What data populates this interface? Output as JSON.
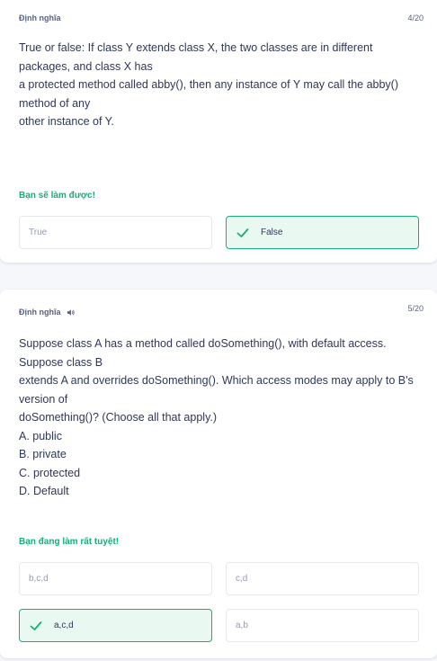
{
  "card1": {
    "category": "Định nghĩa",
    "counter": "4/20",
    "question": "True or false: If class Y extends class X, the two classes are in different packages, and class X has\na protected method called abby(), then any instance of Y may call the abby() method of any\nother instance of Y.",
    "feedback": "Bạn sẽ làm được!",
    "options": [
      {
        "label": "True"
      },
      {
        "label": "False"
      }
    ]
  },
  "card2": {
    "category": "Định nghĩa",
    "counter": "5/20",
    "question": "Suppose class A has a method called doSomething(), with default access. Suppose class B\nextends A and overrides doSomething(). Which access modes may apply to B's version of\ndoSomething()? (Choose all that apply.)\nA. public\nB. private\nC. protected\nD. Default",
    "feedback": "Bạn đang làm rất tuyệt!",
    "options": [
      {
        "label": "b,c,d"
      },
      {
        "label": "c,d"
      },
      {
        "label": "a,c,d"
      },
      {
        "label": "a,b"
      }
    ]
  },
  "colors": {
    "correct": "#18ae79",
    "text": "#2e3856",
    "muted": "#939bb4"
  }
}
